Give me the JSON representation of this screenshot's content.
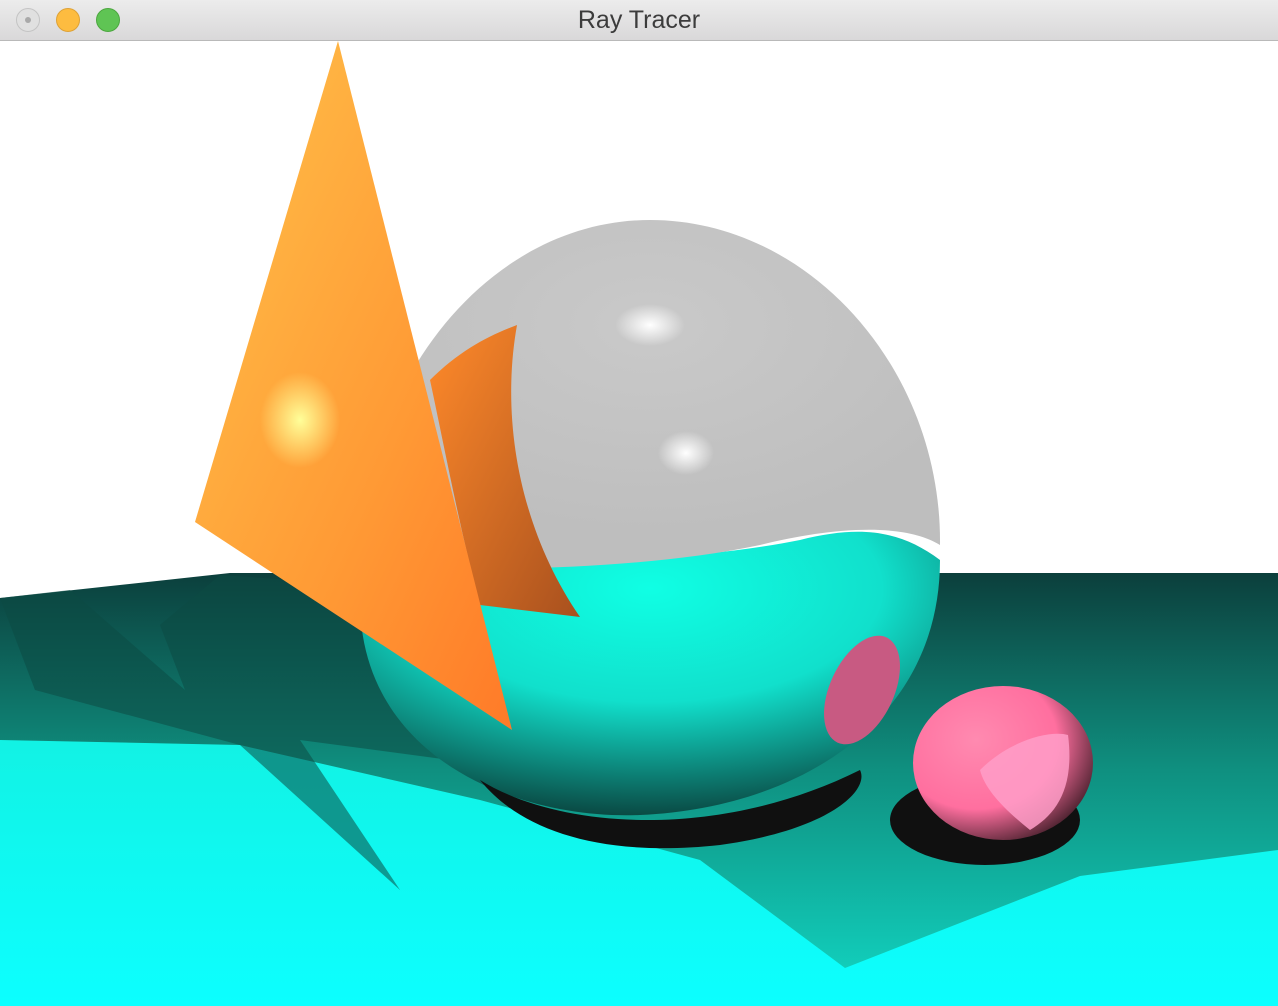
{
  "window": {
    "title": "Ray Tracer"
  },
  "scene": {
    "description_colors": {
      "floor": "#10ffee",
      "floor_shadow": "#0e9a8a",
      "mirror_sphere": "#c0c0c0",
      "cone": "#ffa23a",
      "pink_sphere": "#ff6fa0",
      "background": "#ffffff"
    }
  }
}
